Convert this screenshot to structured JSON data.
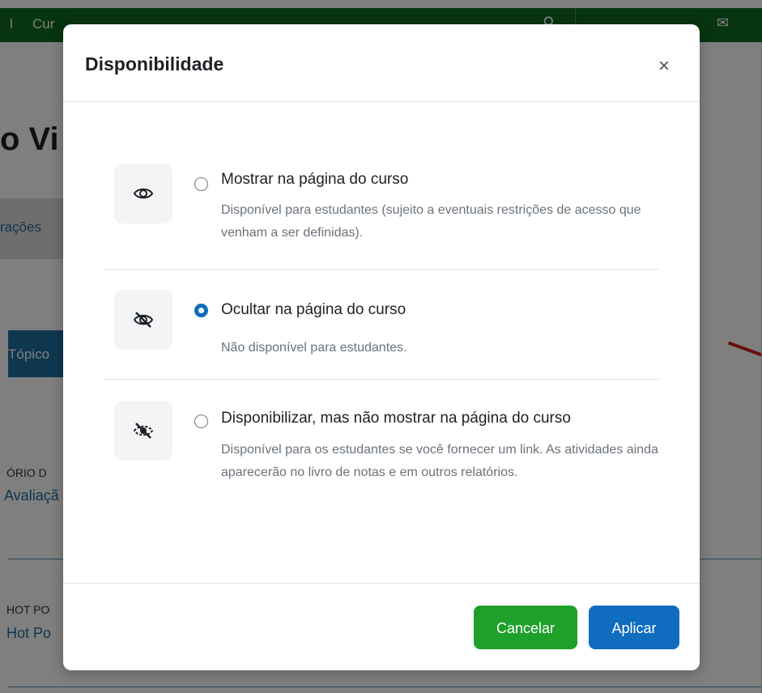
{
  "background": {
    "nav_text_1": "l",
    "nav_text_2": "Cur",
    "page_title": "o Vi",
    "tab_label": "rações",
    "topic_label": "Tópico",
    "activity1_type": "ÓRIO D",
    "activity1_link": "Avaliaçã",
    "activity2_type": "HOT PO",
    "activity2_link": "Hot Po"
  },
  "modal": {
    "title": "Disponibilidade",
    "close_label": "×",
    "options": [
      {
        "label": "Mostrar na página do curso",
        "description": "Disponível para estudantes (sujeito a eventuais restrições de acesso que venham a ser definidas).",
        "icon": "eye-icon",
        "selected": false
      },
      {
        "label": "Ocultar na página do curso",
        "description": "Não disponível para estudantes.",
        "icon": "eye-slash-icon",
        "selected": true
      },
      {
        "label": "Disponibilizar, mas não mostrar na página do curso",
        "description": "Disponível para os estudantes se você fornecer um link. As atividades ainda aparecerão no livro de notas e em outros relatórios.",
        "icon": "eye-slash-dashed-icon",
        "selected": false
      }
    ],
    "cancel_label": "Cancelar",
    "apply_label": "Aplicar"
  },
  "colors": {
    "topbar": "#0f6b1f",
    "primary": "#0f6cbf",
    "cancel": "#1fa02a"
  }
}
